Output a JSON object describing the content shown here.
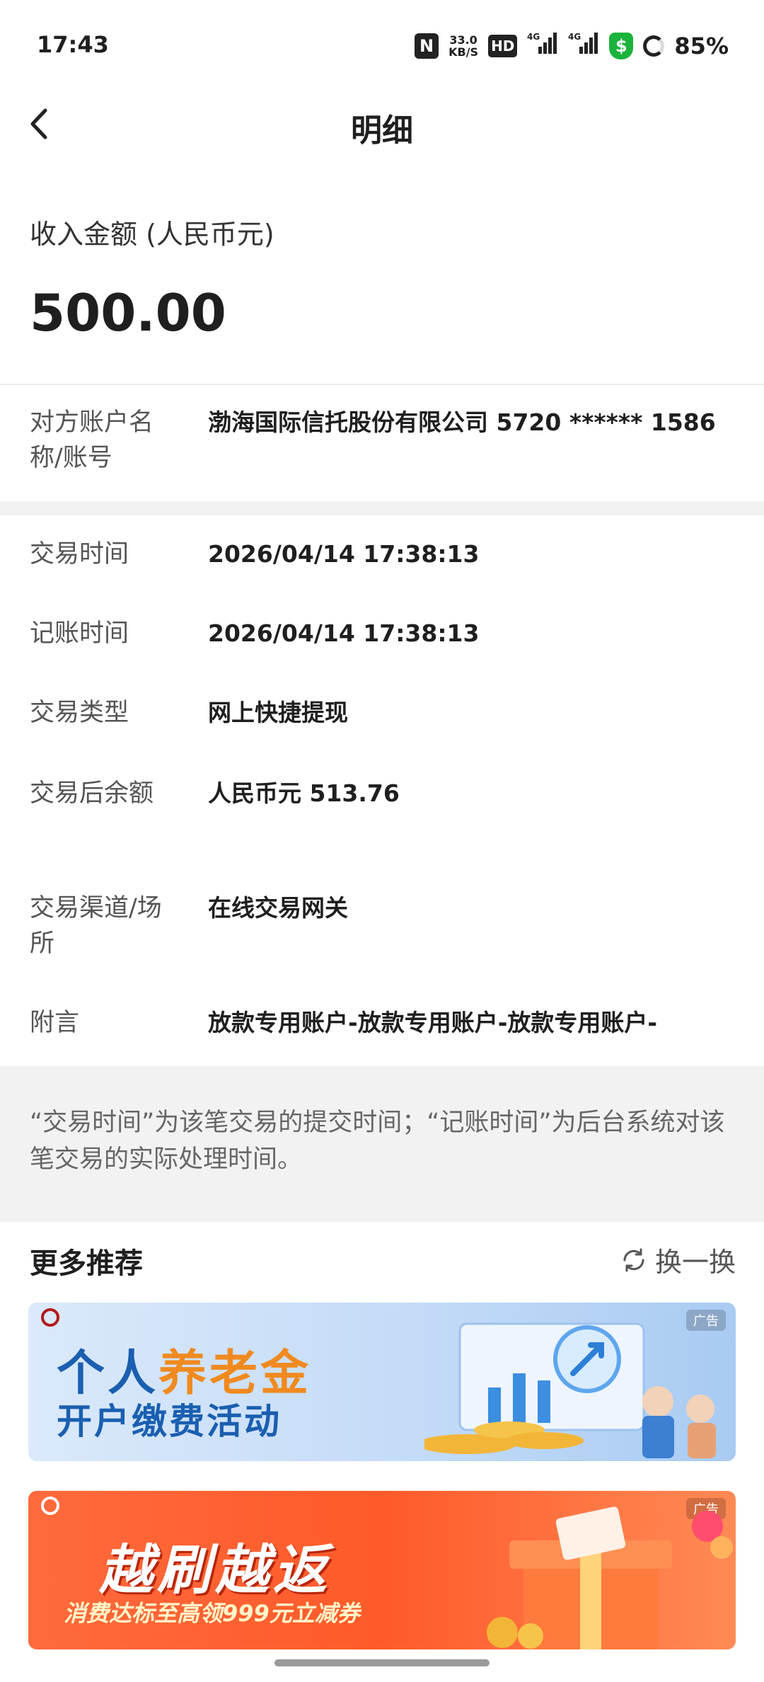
{
  "status_bar": {
    "time": "17:43",
    "nfc_label": "N",
    "net_speed_value": "33.0",
    "net_speed_unit": "KB/S",
    "hd_label": "HD",
    "signal1_label": "4G",
    "signal2_label": "4G",
    "battery_text": "85%"
  },
  "header": {
    "title": "明细"
  },
  "income": {
    "label": "收入金额 (人民币元)",
    "amount": "500.00"
  },
  "details": {
    "counterparty": {
      "label": "对方账户名称/账号",
      "value": "渤海国际信托股份有限公司 5720 ****** 1586"
    },
    "trade_time": {
      "label": "交易时间",
      "value": "2026/04/14 17:38:13"
    },
    "posting_time": {
      "label": "记账时间",
      "value": "2026/04/14 17:38:13"
    },
    "trade_type": {
      "label": "交易类型",
      "value": "网上快捷提现"
    },
    "balance": {
      "label": "交易后余额",
      "value": "人民币元 513.76"
    },
    "channel": {
      "label": "交易渠道/场所",
      "value": "在线交易网关"
    },
    "memo": {
      "label": "附言",
      "value": "放款专用账户-放款专用账户-放款专用账户-"
    }
  },
  "note": "“交易时间”为该笔交易的提交时间；“记账时间”为后台系统对该笔交易的实际处理时间。",
  "recommend": {
    "title": "更多推荐",
    "refresh_label": "换一换",
    "banners": [
      {
        "ad_tag": "广告",
        "line1_a": "个人",
        "line1_b": "养老金",
        "line2": "开户缴费活动"
      },
      {
        "ad_tag": "广告",
        "line1": "越刷越返",
        "line2": "消费达标至高领999元立减券"
      }
    ]
  }
}
